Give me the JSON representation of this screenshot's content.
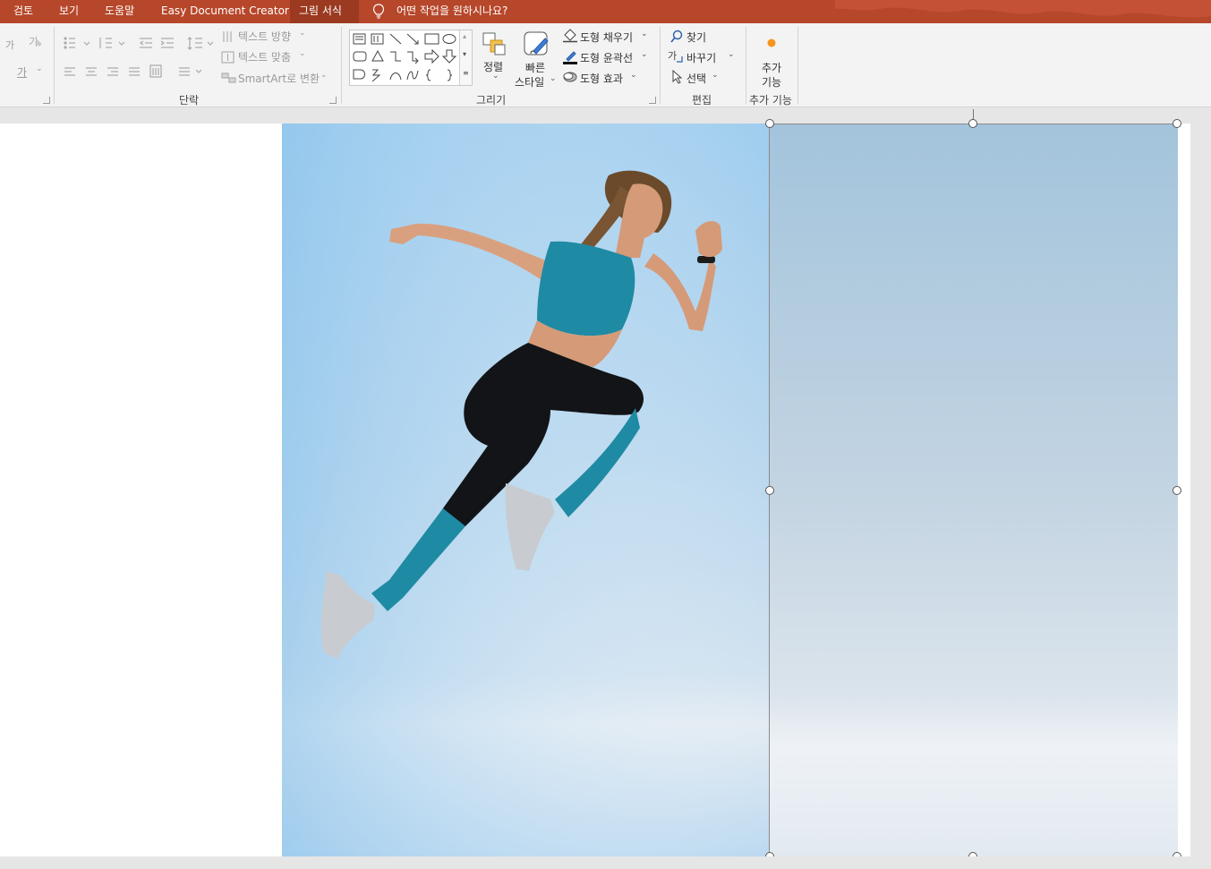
{
  "tabs": [
    {
      "label": "검토",
      "active": false
    },
    {
      "label": "보기",
      "active": false
    },
    {
      "label": "도움말",
      "active": false
    },
    {
      "label": "Easy Document Creator",
      "active": false
    },
    {
      "label": "그림 서식",
      "active": true
    }
  ],
  "tell_me": "어떤 작업을 원하시나요?",
  "colors": {
    "tab_bar": "#b7472a",
    "ribbon_bg": "#f3f3f3",
    "sky_top": "#9fcdee",
    "sky_bottom": "#e8eef5"
  },
  "ribbon": {
    "font_group": {
      "small_a": "가",
      "clear_a": "가",
      "underline_a": "가"
    },
    "paragraph": {
      "label": "단락",
      "text_direction": "텍스트 방향",
      "text_align": "텍스트 맞춤",
      "smartart": "SmartArt로 변환"
    },
    "drawing": {
      "label": "그리기",
      "arrange": "정렬",
      "quick_styles_1": "빠른",
      "quick_styles_2": "스타일",
      "shape_fill": "도형 채우기",
      "shape_outline": "도형 윤곽선",
      "shape_effects": "도형 효과"
    },
    "editing": {
      "label": "편집",
      "find": "찾기",
      "replace": "바꾸기",
      "select": "선택"
    },
    "addins": {
      "label": "추가 기능",
      "button_1": "추가",
      "button_2": "기능"
    }
  }
}
